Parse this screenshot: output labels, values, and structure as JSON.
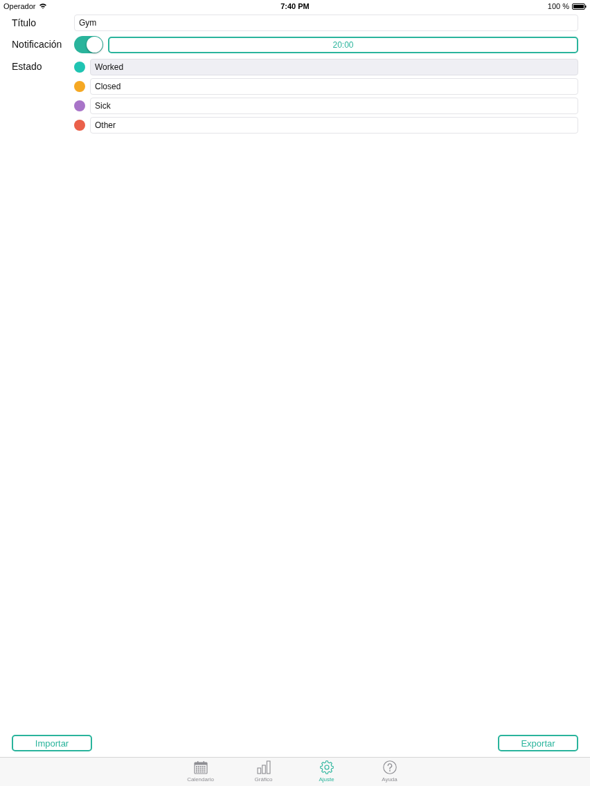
{
  "status_bar": {
    "carrier": "Operador",
    "time": "7:40 PM",
    "battery": "100 %"
  },
  "form": {
    "title": {
      "label": "Título",
      "value": "Gym"
    },
    "notification": {
      "label": "Notificación",
      "on": true,
      "time": "20:00"
    },
    "states": {
      "label": "Estado",
      "items": [
        {
          "name": "Worked",
          "color": "#1fc4b2",
          "selected": true
        },
        {
          "name": "Closed",
          "color": "#f5a823",
          "selected": false
        },
        {
          "name": "Sick",
          "color": "#a874c8",
          "selected": false
        },
        {
          "name": "Other",
          "color": "#ea604a",
          "selected": false
        }
      ]
    }
  },
  "actions": [
    {
      "label": "Importar"
    },
    {
      "label": "Exportar"
    }
  ],
  "tab_bar": [
    {
      "label": "Calendario",
      "kind": "calendar",
      "selected": false
    },
    {
      "label": "Gráfico",
      "kind": "chart",
      "selected": false
    },
    {
      "label": "Ajuste",
      "kind": "gear",
      "selected": true
    },
    {
      "label": "Ayuda",
      "kind": "help",
      "selected": false
    }
  ]
}
